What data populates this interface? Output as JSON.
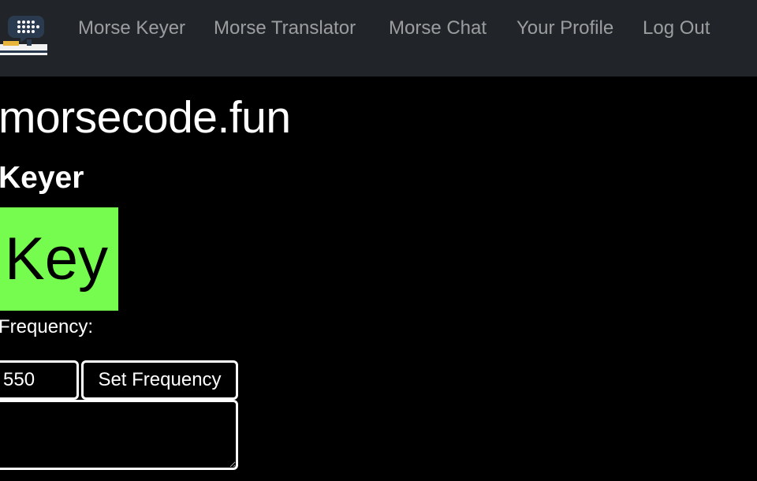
{
  "nav": {
    "logo_icon": "morse-chat-logo-icon",
    "links": [
      {
        "label": "Morse Keyer"
      },
      {
        "label": "Morse Translator"
      },
      {
        "label": "Morse Chat"
      },
      {
        "label": "Your Profile"
      },
      {
        "label": "Log Out"
      }
    ]
  },
  "main": {
    "site_title": "morsecode.fun",
    "section_heading": "Keyer",
    "key_button_label": "Key",
    "frequency_label": "Frequency:",
    "frequency_value": "550",
    "set_frequency_label": "Set Frequency",
    "output_text": ""
  },
  "colors": {
    "navbar_bg": "#212529",
    "page_bg": "#000000",
    "key_button_bg": "#76FB4F",
    "nav_link": "rgba(255,255,255,0.55)"
  }
}
